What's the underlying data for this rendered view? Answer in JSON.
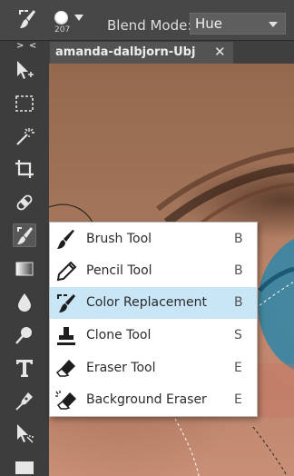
{
  "options_bar": {
    "active_tool_icon": "color-replacement-icon",
    "brush_size": "207",
    "blend_mode_label": "Blend Mode:",
    "blend_mode_value": "Hue"
  },
  "document_tab": {
    "title": "amanda-dalbjorn-Ubj",
    "close_glyph": "✕"
  },
  "toolbox": {
    "collapse_glyph": "> <",
    "tools": [
      {
        "name": "move-icon",
        "active": false
      },
      {
        "name": "marquee-icon",
        "active": false
      },
      {
        "name": "magic-wand-icon",
        "active": false
      },
      {
        "name": "crop-icon",
        "active": false
      },
      {
        "name": "healing-icon",
        "active": false
      },
      {
        "name": "color-replacement-icon",
        "active": true
      },
      {
        "name": "gradient-icon",
        "active": false
      },
      {
        "name": "drop-icon",
        "active": false
      },
      {
        "name": "dodge-icon",
        "active": false
      },
      {
        "name": "text-icon",
        "active": false
      },
      {
        "name": "pen-icon",
        "active": false
      },
      {
        "name": "path-select-icon",
        "active": false
      },
      {
        "name": "shape-icon",
        "active": false
      }
    ]
  },
  "tool_menu": {
    "items": [
      {
        "label": "Brush Tool",
        "shortcut": "B",
        "icon": "brush-icon"
      },
      {
        "label": "Pencil Tool",
        "shortcut": "B",
        "icon": "pencil-icon"
      },
      {
        "label": "Color Replacement",
        "shortcut": "B",
        "icon": "color-replacement-icon"
      },
      {
        "label": "Clone Tool",
        "shortcut": "S",
        "icon": "stamp-icon"
      },
      {
        "label": "Eraser Tool",
        "shortcut": "E",
        "icon": "eraser-icon"
      },
      {
        "label": "Background Eraser",
        "shortcut": "E",
        "icon": "background-eraser-icon"
      }
    ],
    "highlighted_index": 2
  },
  "colors": {
    "ui_dark": "#3d3d3d",
    "menu_highlight": "#c9e6f7",
    "iris_blue": "#2e86a8"
  }
}
